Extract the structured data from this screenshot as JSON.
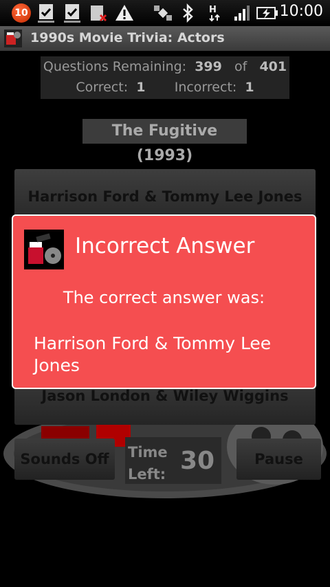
{
  "status_bar": {
    "notification_count": "10",
    "time": "10:00",
    "icons": [
      "notification-badge-icon",
      "task-done-icon",
      "task-done-icon",
      "sd-card-error-icon",
      "warning-icon",
      "satellite-icon",
      "bluetooth-icon",
      "hspa-data-icon",
      "signal-icon",
      "battery-charging-icon"
    ]
  },
  "app": {
    "title": "1990s Movie Trivia: Actors"
  },
  "score": {
    "questions_remaining_label": "Questions Remaining:",
    "questions_remaining": "399",
    "of_label": "of",
    "total": "401",
    "correct_label": "Correct:",
    "correct": "1",
    "incorrect_label": "Incorrect:",
    "incorrect": "1"
  },
  "question": {
    "movie": "The Fugitive (1993)"
  },
  "answers": {
    "first": "Harrison Ford & Tommy Lee Jones",
    "last": "Jason London & Wiley Wiggins"
  },
  "controls": {
    "sounds_label": "Sounds Off",
    "time_left_label": "Time Left:",
    "time_left_value": "30",
    "pause_label": "Pause"
  },
  "dialog": {
    "title": "Incorrect Answer",
    "message": "The correct answer was:",
    "answer": "Harrison Ford & Tommy Lee Jones"
  }
}
